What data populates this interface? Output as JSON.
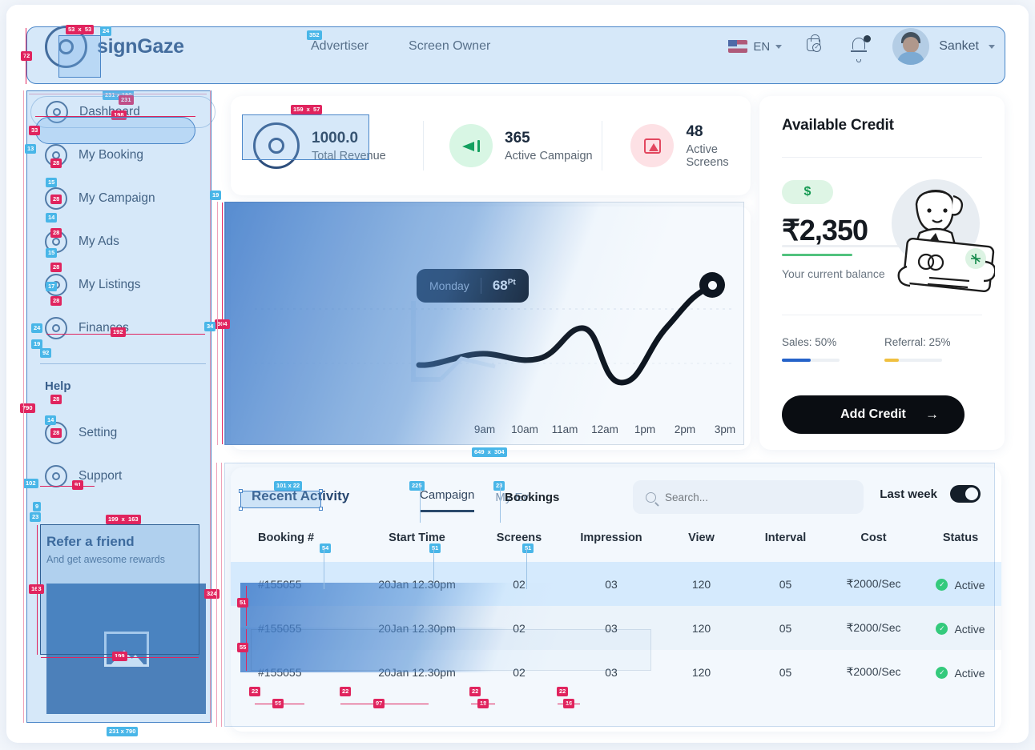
{
  "header": {
    "brand": "signGaze",
    "nav": [
      {
        "label": "Advertiser"
      },
      {
        "label": "Screen Owner"
      }
    ],
    "language": "EN",
    "user": "Sanket",
    "icons": {
      "bag": "shopping-bag-check-icon",
      "bell": "notification-bell-icon",
      "flag": "us-flag-icon"
    }
  },
  "sidebar": {
    "items": [
      {
        "label": "Dashboard",
        "active": true
      },
      {
        "label": "My Booking",
        "active": false
      },
      {
        "label": "My Campaign",
        "active": false
      },
      {
        "label": "My Ads",
        "active": false
      },
      {
        "label": "My Listings",
        "active": false
      },
      {
        "label": "Finances",
        "active": false
      }
    ],
    "help_heading": "Help",
    "help_items": [
      {
        "label": "Setting"
      },
      {
        "label": "Support"
      }
    ],
    "refer": {
      "title": "Refer a friend",
      "subtitle": "And get awesome rewards",
      "image_placeholder": "image-placeholder-icon"
    }
  },
  "stats": [
    {
      "value": "1000.0",
      "label": "Total Revenue",
      "icon": "ring-logo-icon"
    },
    {
      "value": "365",
      "label": "Active Campaign",
      "icon": "megaphone-icon",
      "color": "#13a05f"
    },
    {
      "value": "48",
      "label": "Active Screens",
      "icon": "screen-icon",
      "color": "#e2475f"
    }
  ],
  "chart_data": {
    "type": "line",
    "title": "",
    "x": [
      "9am",
      "10am",
      "11am",
      "12am",
      "1pm",
      "2pm",
      "3pm"
    ],
    "values": [
      30,
      34,
      31,
      40,
      12,
      28,
      68
    ],
    "tooltip": {
      "day": "Monday",
      "value": "68",
      "unit": "Pt"
    },
    "xlabel": "",
    "ylabel": "",
    "grid": true,
    "legend": "none"
  },
  "credit": {
    "title": "Available Credit",
    "currency_badge": "$",
    "amount": "₹2,350",
    "subtitle": "Your current balance",
    "metrics": [
      {
        "label": "Sales: 50%",
        "percent": 50,
        "color": "#2563c9"
      },
      {
        "label": "Referral: 25%",
        "percent": 25,
        "color": "#f0c040"
      }
    ],
    "button": "Add Credit",
    "button_icon": "arrow-right-icon"
  },
  "activity": {
    "title": "Recent Activity",
    "tabs": [
      {
        "label": "Campaign",
        "active": true
      },
      {
        "label": "My Ev",
        "active": false
      },
      {
        "label": "Bookings",
        "active": false
      }
    ],
    "search_placeholder": "Search...",
    "filter_label": "Last week",
    "filter_on": true,
    "columns": [
      "Booking #",
      "Start Time",
      "Screens",
      "Impression",
      "View",
      "Interval",
      "Cost",
      "Status"
    ],
    "rows": [
      {
        "booking": "#155055",
        "start": "20Jan 12.30pm",
        "screens": "02",
        "impression": "03",
        "view": "120",
        "interval": "05",
        "cost": "₹2000/Sec",
        "status": "Active"
      },
      {
        "booking": "#155055",
        "start": "20Jan 12.30pm",
        "screens": "02",
        "impression": "03",
        "view": "120",
        "interval": "05",
        "cost": "₹2000/Sec",
        "status": "Active"
      },
      {
        "booking": "#155055",
        "start": "20Jan 12.30pm",
        "screens": "02",
        "impression": "03",
        "view": "120",
        "interval": "05",
        "cost": "₹2000/Sec",
        "status": "Active"
      }
    ]
  },
  "annotations": {
    "measurements": [
      "53 x 53",
      "72",
      "24",
      "231 x 190",
      "231",
      "352",
      "198",
      "33",
      "13",
      "28",
      "15",
      "14",
      "17",
      "24",
      "19",
      "192",
      "92",
      "790",
      "304",
      "159 x 57",
      "649 x 304",
      "101 x 22",
      "225",
      "23",
      "54",
      "51",
      "91",
      "199 x 163",
      "163",
      "199",
      "231 x 790",
      "324",
      "55",
      "97",
      "22",
      "18",
      "16",
      "34",
      "9"
    ]
  }
}
